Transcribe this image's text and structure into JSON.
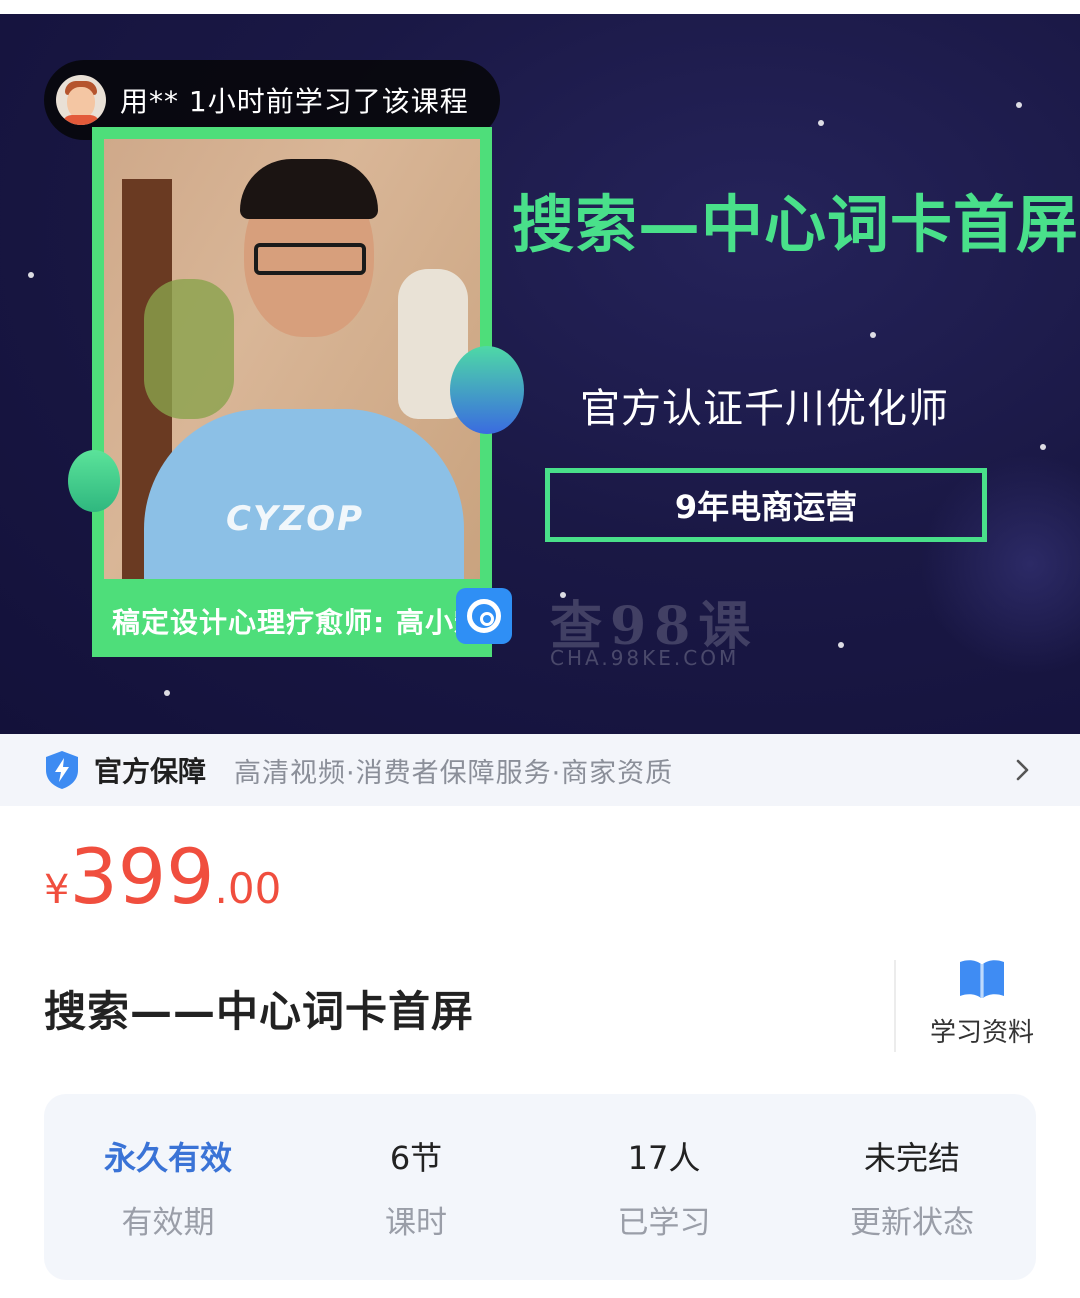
{
  "banner": {
    "ticker": "用** 1小时前学习了该课程",
    "title": "搜索—中心词卡首屏",
    "subtitle": "官方认证千川优化师",
    "box_text": "9年电商运营",
    "caption": "稿定设计心理疗愈师: 高小宏",
    "shirt_print": "CYZOP",
    "watermark": "查98课",
    "watermark_sub": "CHA.98KE.COM",
    "accent_green": "#49e08a",
    "bg_color": "#1a1845"
  },
  "guarantee": {
    "title": "官方保障",
    "items": "高清视频·消费者保障服务·商家资质",
    "icon": "shield-bolt-icon",
    "chevron": "chevron-right-icon"
  },
  "price": {
    "currency": "¥",
    "integer": "399",
    "decimal": ".00",
    "color": "#f04e3e"
  },
  "course": {
    "title": "搜索——中心词卡首屏",
    "materials_label": "学习资料",
    "materials_icon": "book-icon"
  },
  "stats": [
    {
      "value": "永久有效",
      "label": "有效期",
      "accent": true
    },
    {
      "value": "6节",
      "label": "课时",
      "accent": false
    },
    {
      "value": "17人",
      "label": "已学习",
      "accent": false
    },
    {
      "value": "未完结",
      "label": "更新状态",
      "accent": false
    }
  ]
}
